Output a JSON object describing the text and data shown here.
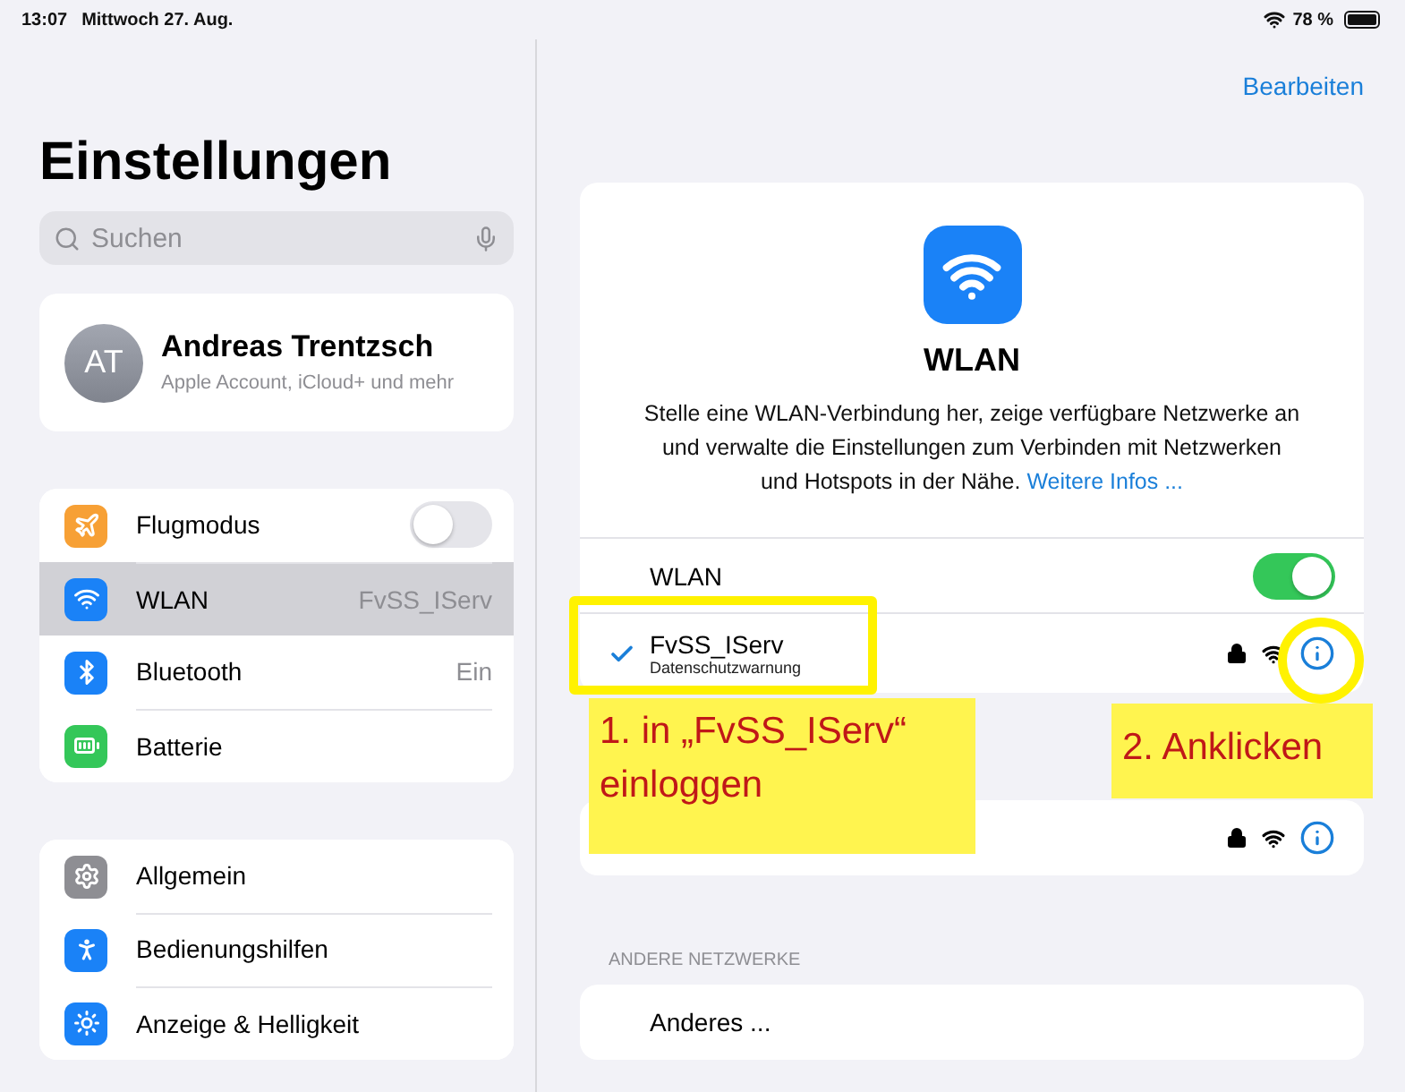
{
  "status_bar": {
    "time": "13:07",
    "date": "Mittwoch 27. Aug.",
    "battery": "78 %"
  },
  "sidebar": {
    "title": "Einstellungen",
    "search": {
      "placeholder": "Suchen"
    },
    "account": {
      "initials": "AT",
      "name": "Andreas Trentzsch",
      "subtitle": "Apple Account, iCloud+ und mehr"
    },
    "groups": [
      [
        {
          "label": "Flugmodus",
          "color": "#f7a035",
          "kind": "toggle",
          "on": false,
          "selected": false
        },
        {
          "label": "WLAN",
          "color": "#1a82f7",
          "kind": "value",
          "value": "FvSS_IServ",
          "selected": true
        },
        {
          "label": "Bluetooth",
          "color": "#1a82f7",
          "kind": "value",
          "value": "Ein",
          "selected": false
        },
        {
          "label": "Batterie",
          "color": "#34c759",
          "kind": "plain",
          "selected": false
        }
      ],
      [
        {
          "label": "Allgemein",
          "color": "#8e8e93",
          "kind": "plain",
          "selected": false
        },
        {
          "label": "Bedienungshilfen",
          "color": "#1a82f7",
          "kind": "plain",
          "selected": false
        },
        {
          "label": "Anzeige & Helligkeit",
          "color": "#1a82f7",
          "kind": "plain",
          "selected": false
        }
      ]
    ]
  },
  "detail": {
    "edit_button": "Bearbeiten",
    "hero": {
      "title": "WLAN",
      "description": "Stelle eine WLAN-Verbindung her, zeige verfügbare Netzwerke an und verwalte die Einstellungen zum Verbinden mit Netzwerken und Hotspots in der Nähe.",
      "link": "Weitere Infos ..."
    },
    "wlan_toggle": {
      "label": "WLAN",
      "on": true
    },
    "connected": {
      "name": "FvSS_IServ",
      "subtitle": "Datenschutzwarnung",
      "selected": true,
      "locked": true
    },
    "my_networks": [
      {
        "locked": true
      }
    ],
    "other_header": "ANDERE NETZWERKE",
    "other_rows": [
      "Anderes ..."
    ]
  },
  "annotations": [
    {
      "text": "1. in „FvSS_IServ“ einloggen"
    },
    {
      "text": "2. Anklicken"
    }
  ]
}
